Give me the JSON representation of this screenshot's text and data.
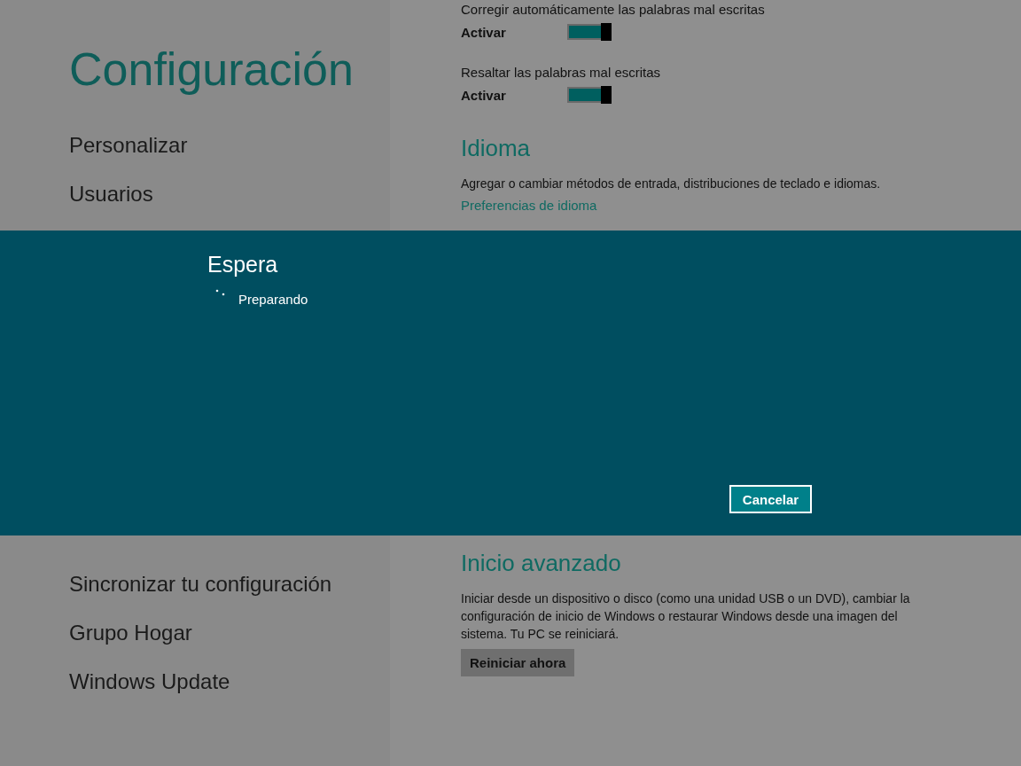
{
  "sidebar": {
    "title": "Configuración",
    "items_above": [
      {
        "label": "Personalizar"
      },
      {
        "label": "Usuarios"
      }
    ],
    "items_below": [
      {
        "label": "Sincronizar tu configuración"
      },
      {
        "label": "Grupo Hogar"
      },
      {
        "label": "Windows Update"
      }
    ]
  },
  "settings": [
    {
      "label": "Corregir automáticamente las palabras mal escritas",
      "state_label": "Activar",
      "on": true
    },
    {
      "label": "Resaltar las palabras mal escritas",
      "state_label": "Activar",
      "on": true
    }
  ],
  "language": {
    "heading": "Idioma",
    "description": "Agregar o cambiar métodos de entrada, distribuciones de teclado e idiomas.",
    "link": "Preferencias de idioma"
  },
  "advanced_startup": {
    "heading": "Inicio avanzado",
    "description": "Iniciar desde un dispositivo o disco (como una unidad USB o un DVD), cambiar la configuración de inicio de Windows o restaurar Windows desde una imagen del sistema. Tu PC se reiniciará.",
    "button": "Reiniciar ahora"
  },
  "dialog": {
    "title": "Espera",
    "status": "Preparando",
    "button": "Cancelar"
  }
}
